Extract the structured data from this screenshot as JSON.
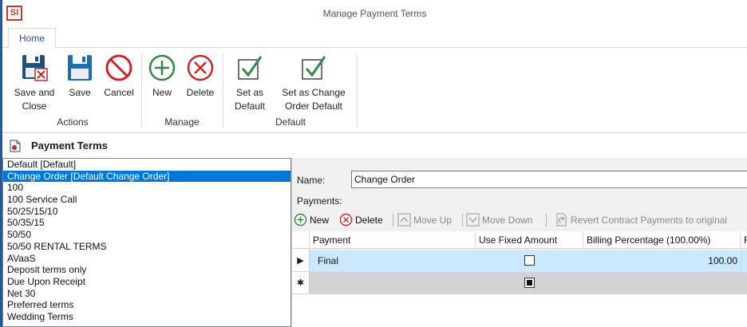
{
  "window": {
    "app_logo": "SI",
    "title": "Manage Payment Terms"
  },
  "ribbon": {
    "tab": "Home",
    "groups": {
      "actions": {
        "label": "Actions",
        "save_close": "Save and\nClose",
        "save": "Save",
        "cancel": "Cancel"
      },
      "manage": {
        "label": "Manage",
        "new": "New",
        "delete": "Delete"
      },
      "default": {
        "label": "Default",
        "set_default": "Set as\nDefault",
        "set_co_default": "Set as Change\nOrder Default"
      }
    }
  },
  "section": {
    "title": "Payment Terms"
  },
  "terms": [
    "Default [Default]",
    "Change Order [Default Change Order]",
    "100",
    "100 Service Call",
    "50/25/15/10",
    "50/35/15",
    "50/50",
    "50/50 RENTAL TERMS",
    "AVaaS",
    "Deposit terms only",
    "Due Upon Receipt",
    "Net 30",
    "Preferred terms",
    "Wedding Terms"
  ],
  "selected_index": 1,
  "detail": {
    "name_label": "Name:",
    "name_value": "Change Order",
    "payments_label": "Payments:",
    "toolbar": {
      "new": "New",
      "delete": "Delete",
      "move_up": "Move Up",
      "move_down": "Move Down",
      "revert": "Revert Contract Payments to original"
    },
    "grid": {
      "columns": [
        "Payment",
        "Use Fixed Amount",
        "Billing Percentage (100.00%)",
        "F"
      ],
      "rows": [
        {
          "marker": "▶",
          "payment": "Final",
          "use_fixed": false,
          "billing": "100.00"
        },
        {
          "marker": "✱",
          "payment": "",
          "use_fixed": null,
          "billing": ""
        }
      ]
    }
  },
  "colors": {
    "accent": "#0078d7",
    "tab_text": "#2b579a",
    "row_selected": "#cce8ff",
    "new_row": "#d3d3d3",
    "green_icon": "#2e8b3e",
    "red_icon": "#c62828",
    "navy_icon": "#1f4e79"
  }
}
